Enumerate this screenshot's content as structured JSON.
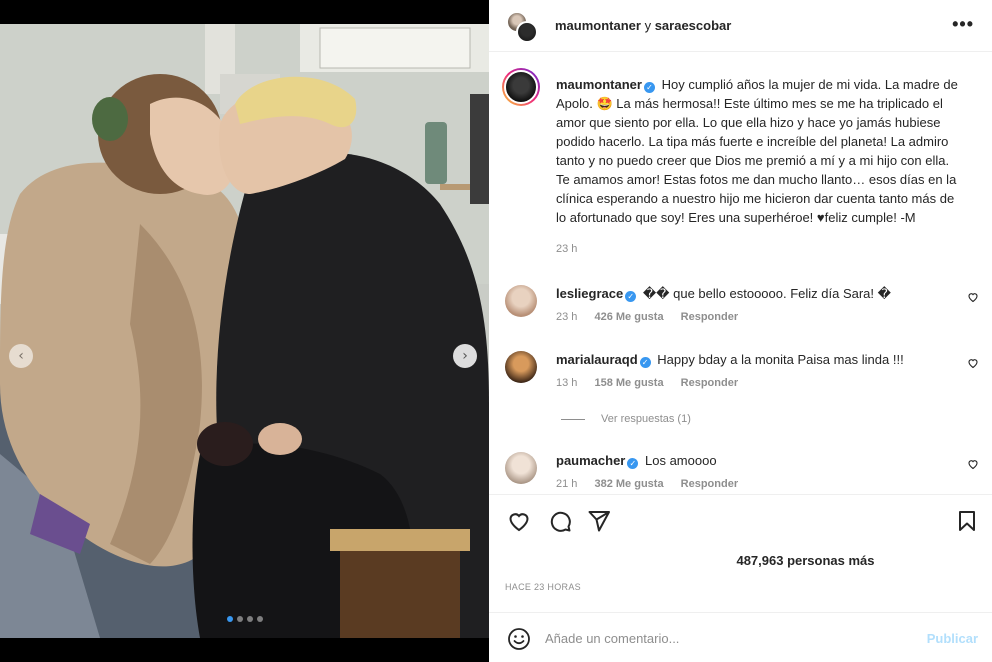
{
  "header": {
    "user1": "maumontaner",
    "conjunction": " y ",
    "user2": "saraescobar",
    "more_icon": "more-horizontal-icon"
  },
  "post": {
    "author": "maumontaner",
    "caption": "Hoy cumplió años la mujer de mi vida. La madre de Apolo. 🤩 La más hermosa!! Este último mes se me ha triplicado el amor que siento por ella. Lo que ella hizo y hace yo jamás hubiese podido hacerlo. La tipa más fuerte e increíble del planeta! La admiro tanto y no puedo creer que Dios me premió a mí y a mi hijo con ella. Te amamos amor! Estas fotos me dan mucho llanto… esos días en la clínica esperando a nuestro hijo me hicieron dar cuenta tanto más de lo afortunado que soy! Eres una superhéroe! ♥feliz cumple! -M",
    "time": "23 h",
    "carousel": {
      "count": 4,
      "active_index": 0
    }
  },
  "comments": [
    {
      "user": "lesliegrace",
      "text": "�� que bello estooooo. Feliz día Sara! �",
      "time": "23 h",
      "likes": "426 Me gusta",
      "reply": "Responder"
    },
    {
      "user": "marialauraqd",
      "text": "Happy bday a la monita Paisa mas linda !!!",
      "time": "13 h",
      "likes": "158 Me gusta",
      "reply": "Responder"
    },
    {
      "user": "paumacher",
      "text": "Los amoooo",
      "time": "21 h",
      "likes": "382 Me gusta",
      "reply": "Responder"
    }
  ],
  "view_replies": "Ver respuestas (1)",
  "likes_text": "487,963 personas más",
  "timestamp": "HACE 23 HORAS",
  "comment_box": {
    "placeholder": "Añade un comentario...",
    "post_label": "Publicar"
  },
  "icons": {
    "like": "heart-icon",
    "comment": "comment-icon",
    "share": "share-icon",
    "save": "bookmark-icon",
    "emoji": "emoji-icon",
    "verified": "verified-badge-icon"
  },
  "colors": {
    "accent": "#3897f0",
    "post_disabled": "#b2dffc",
    "muted": "#8e8e8e"
  }
}
